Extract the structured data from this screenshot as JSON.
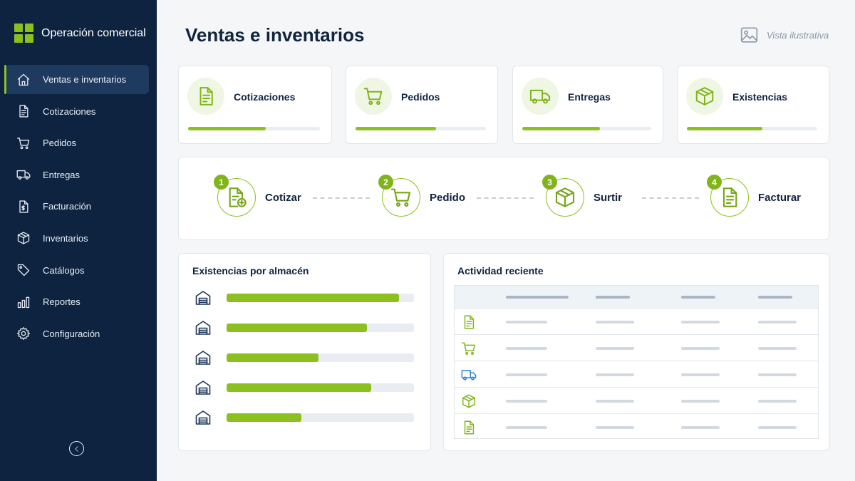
{
  "app": {
    "name": "Operación comercial",
    "brand_color": "#8cc01f"
  },
  "sidebar": {
    "items": [
      {
        "label": "Ventas e inventarios",
        "icon": "home-icon",
        "active": true
      },
      {
        "label": "Cotizaciones",
        "icon": "document-icon"
      },
      {
        "label": "Pedidos",
        "icon": "cart-icon"
      },
      {
        "label": "Entregas",
        "icon": "truck-icon"
      },
      {
        "label": "Facturación",
        "icon": "invoice-icon"
      },
      {
        "label": "Inventarios",
        "icon": "box-icon"
      },
      {
        "label": "Catálogos",
        "icon": "tag-icon"
      },
      {
        "label": "Reportes",
        "icon": "bar-chart-icon"
      },
      {
        "label": "Configuración",
        "icon": "gear-icon"
      }
    ],
    "collapse_icon": "chevron-left-icon"
  },
  "header": {
    "title": "Ventas e inventarios",
    "badge_label": "Vista ilustrativa",
    "badge_icon": "image-icon"
  },
  "kpis": [
    {
      "label": "Cotizaciones",
      "icon": "document-icon",
      "progress": 0.59
    },
    {
      "label": "Pedidos",
      "icon": "cart-icon",
      "progress": 0.62
    },
    {
      "label": "Entregas",
      "icon": "truck-icon",
      "progress": 0.6
    },
    {
      "label": "Existencias",
      "icon": "box-icon",
      "progress": 0.58
    }
  ],
  "process": {
    "steps": [
      {
        "number": "1",
        "label": "Cotizar",
        "icon": "document-add-icon"
      },
      {
        "number": "2",
        "label": "Pedido",
        "icon": "cart-icon"
      },
      {
        "number": "3",
        "label": "Surtir",
        "icon": "box-icon"
      },
      {
        "number": "4",
        "label": "Facturar",
        "icon": "document-icon"
      }
    ]
  },
  "stock": {
    "title": "Existencias por almacén",
    "warehouse_icon": "warehouse-icon",
    "levels": [
      0.92,
      0.75,
      0.49,
      0.77,
      0.4
    ]
  },
  "activity": {
    "title": "Actividad reciente",
    "rows": [
      {
        "icon": "document-icon",
        "color": "#7fb51a"
      },
      {
        "icon": "cart-icon",
        "color": "#7fb51a"
      },
      {
        "icon": "truck-icon",
        "color": "#2f7fd9"
      },
      {
        "icon": "box-icon",
        "color": "#7fb51a"
      },
      {
        "icon": "document-icon",
        "color": "#7fb51a"
      }
    ]
  }
}
